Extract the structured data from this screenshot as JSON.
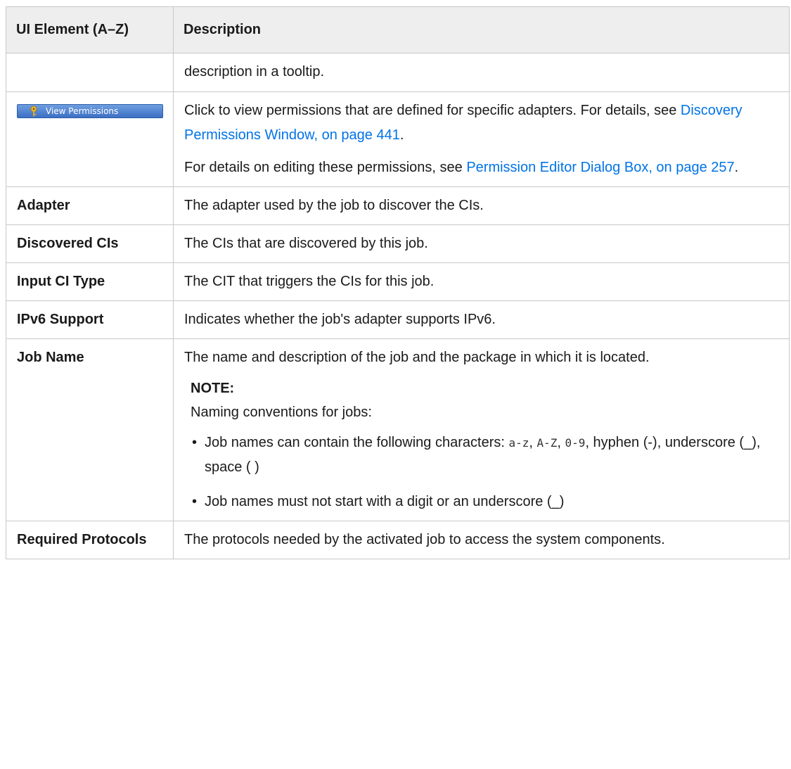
{
  "table": {
    "headers": [
      "UI Element (A–Z)",
      "Description"
    ],
    "rows": [
      {
        "name": "",
        "desc": "description in a tooltip."
      },
      {
        "button": {
          "label": "View Permissions",
          "icon": "key-icon"
        },
        "p1_text": "Click to view permissions that are defined for specific adapters. For details, see ",
        "p1_link": "Discovery Permissions Window, on page 441",
        "p1_end": ".",
        "p2_text": "For details on editing these permissions, see ",
        "p2_link": "Permission Editor Dialog Box, on page 257",
        "p2_end": "."
      },
      {
        "name": "Adapter",
        "desc": "The adapter used by the job to discover the CIs."
      },
      {
        "name": "Discovered CIs",
        "desc": "The CIs that are discovered by this job."
      },
      {
        "name": "Input CI Type",
        "desc": "The CIT that triggers the CIs for this job."
      },
      {
        "name": "IPv6 Support",
        "desc": "Indicates whether the job's adapter supports IPv6."
      },
      {
        "name": "Job Name",
        "desc": "The name and description of the job and the package in which it is located.",
        "note_title": "NOTE:",
        "note_body": "Naming conventions for jobs:",
        "bullet1_text": "Job names can contain the following characters: ",
        "bullet1_codes": [
          "a-z",
          "A-Z",
          "0-9"
        ],
        "bullet1_sep": ", ",
        "bullet1_rest": ", hyphen (-), underscore (_), space ( )",
        "bullet2": "Job names must not start with a digit or an underscore (_)",
        "bullet_symbol": "•"
      },
      {
        "name": "Required Protocols",
        "desc": "The protocols needed by the activated job to access the system components."
      }
    ]
  },
  "colors": {
    "link": "#0073e7",
    "header_bg": "#eeeeee",
    "border": "#c8c8c8"
  }
}
